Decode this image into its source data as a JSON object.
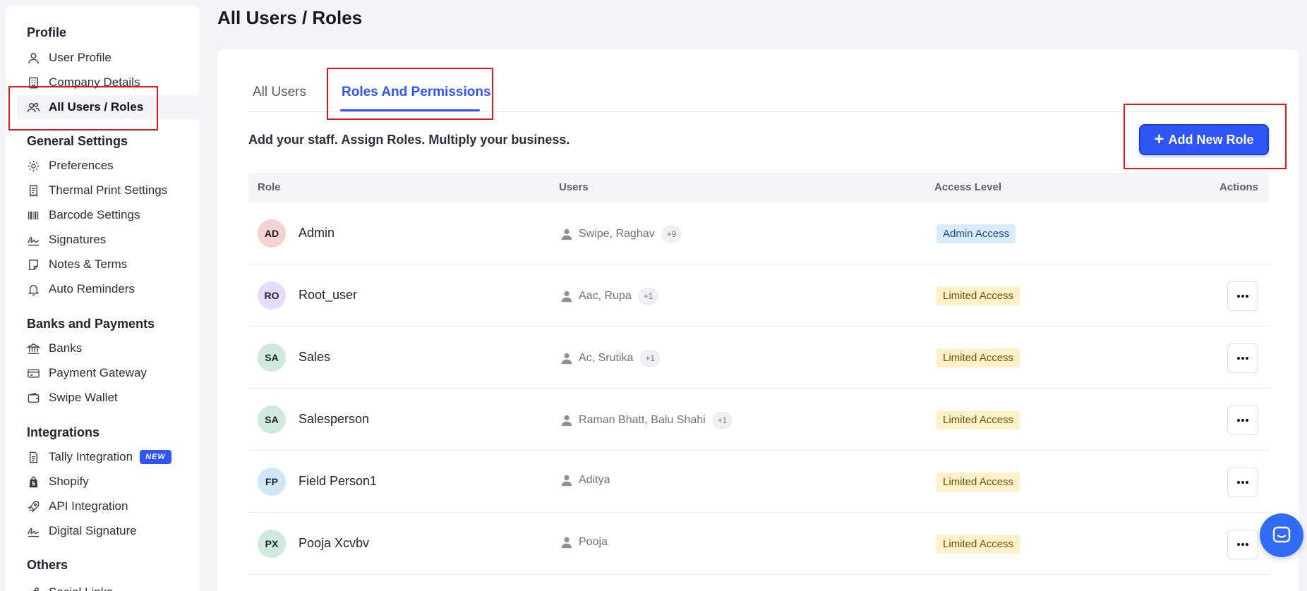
{
  "page": {
    "title": "All Users / Roles"
  },
  "sidebar": {
    "sections": [
      {
        "title": "Profile",
        "items": [
          {
            "label": "User Profile",
            "icon": "user-icon"
          },
          {
            "label": "Company Details",
            "icon": "building-icon"
          },
          {
            "label": "All Users / Roles",
            "icon": "users-icon",
            "active": true
          }
        ]
      },
      {
        "title": "General Settings",
        "items": [
          {
            "label": "Preferences",
            "icon": "gear-icon"
          },
          {
            "label": "Thermal Print Settings",
            "icon": "receipt-icon"
          },
          {
            "label": "Barcode Settings",
            "icon": "barcode-icon"
          },
          {
            "label": "Signatures",
            "icon": "signature-icon"
          },
          {
            "label": "Notes & Terms",
            "icon": "note-icon"
          },
          {
            "label": "Auto Reminders",
            "icon": "bell-icon"
          }
        ]
      },
      {
        "title": "Banks and Payments",
        "items": [
          {
            "label": "Banks",
            "icon": "bank-icon"
          },
          {
            "label": "Payment Gateway",
            "icon": "card-icon"
          },
          {
            "label": "Swipe Wallet",
            "icon": "wallet-icon"
          }
        ]
      },
      {
        "title": "Integrations",
        "items": [
          {
            "label": "Tally Integration",
            "icon": "document-icon",
            "badge": "NEW"
          },
          {
            "label": "Shopify",
            "icon": "shopify-icon"
          },
          {
            "label": "API Integration",
            "icon": "rocket-icon"
          },
          {
            "label": "Digital Signature",
            "icon": "signature-icon"
          }
        ]
      },
      {
        "title": "Others",
        "items": [
          {
            "label": "Social Links",
            "icon": "share-icon"
          }
        ]
      }
    ]
  },
  "tabs": [
    {
      "label": "All Users",
      "active": false
    },
    {
      "label": "Roles And Permissions",
      "active": true
    }
  ],
  "subtitle": "Add your staff. Assign Roles. Multiply your business.",
  "add_button": {
    "label": "Add New Role"
  },
  "table": {
    "headers": {
      "role": "Role",
      "users": "Users",
      "access": "Access Level",
      "actions": "Actions"
    },
    "rows": [
      {
        "initials": "AD",
        "avatar_color": "#f1d3d0",
        "role": "Admin",
        "users": "Swipe, Raghav",
        "more": "+9",
        "access": "Admin Access",
        "access_type": "admin",
        "has_actions": false
      },
      {
        "initials": "RO",
        "avatar_color": "#e3dcfb",
        "role": "Root_user",
        "users": "Aac, Rupa",
        "more": "+1",
        "access": "Limited Access",
        "access_type": "limited",
        "has_actions": true
      },
      {
        "initials": "SA",
        "avatar_color": "#cfe9dc",
        "role": "Sales",
        "users": "Ac, Srutika",
        "more": "+1",
        "access": "Limited Access",
        "access_type": "limited",
        "has_actions": true
      },
      {
        "initials": "SA",
        "avatar_color": "#cfe9dc",
        "role": "Salesperson",
        "users": "Raman Bhatt, Balu Shahi",
        "more": "+1",
        "access": "Limited Access",
        "access_type": "limited",
        "has_actions": true
      },
      {
        "initials": "FP",
        "avatar_color": "#cfe6fb",
        "role": "Field Person1",
        "users": "Aditya",
        "more": "",
        "access": "Limited Access",
        "access_type": "limited",
        "has_actions": true
      },
      {
        "initials": "PX",
        "avatar_color": "#cfe9dc",
        "role": "Pooja Xcvbv",
        "users": "Pooja",
        "more": "",
        "access": "Limited Access",
        "access_type": "limited",
        "has_actions": true
      }
    ]
  },
  "colors": {
    "accent": "#2f55f4",
    "highlight": "#e0161e"
  }
}
